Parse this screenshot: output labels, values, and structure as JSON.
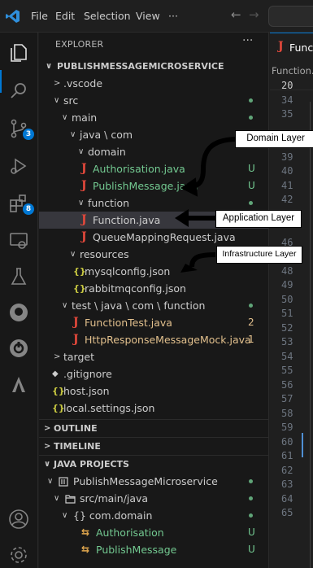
{
  "menu": {
    "file": "File",
    "edit": "Edit",
    "selection": "Selection",
    "view": "View",
    "more": "···",
    "back": "←",
    "forward": "→"
  },
  "activity_bar": {
    "icons": [
      "explorer-icon",
      "search-icon",
      "source-control-icon",
      "run-debug-icon",
      "extensions-icon",
      "remote-explorer-icon",
      "testing-icon",
      "github-icon",
      "azure-icon",
      "docker-icon",
      "account-icon",
      "settings-icon"
    ],
    "source_control_badge": "3",
    "extensions_badge": "8"
  },
  "sidebar": {
    "header": "EXPLORER",
    "more": "···",
    "project": "PUBLISHMESSAGEMICROSERVICE",
    "tree": [
      {
        "label": ".vscode",
        "chev": ">",
        "status": ""
      },
      {
        "label": "src",
        "chev": "∨",
        "status": "dot"
      },
      {
        "label": "main",
        "chev": "∨",
        "status": "dot"
      },
      {
        "label": "java \\ com",
        "chev": "∨",
        "status": ""
      },
      {
        "label": "domain",
        "chev": "∨",
        "status": ""
      },
      {
        "label": "Authorisation.java",
        "chev": "",
        "status": "U"
      },
      {
        "label": "PublishMessage.java",
        "chev": "",
        "status": "U"
      },
      {
        "label": "function",
        "chev": "∨",
        "status": "dot"
      },
      {
        "label": "Function.java",
        "chev": "",
        "status": ""
      },
      {
        "label": "QueueMappingRequest.java",
        "chev": "",
        "status": ""
      },
      {
        "label": "resources",
        "chev": "∨",
        "status": ""
      },
      {
        "label": "mysqlconfig.json",
        "chev": "",
        "status": ""
      },
      {
        "label": "rabbitmqconfig.json",
        "chev": "",
        "status": ""
      },
      {
        "label": "test \\ java \\ com \\ function",
        "chev": "∨",
        "status": "dot"
      },
      {
        "label": "FunctionTest.java",
        "chev": "",
        "status": "2"
      },
      {
        "label": "HttpResponseMessageMock.java",
        "chev": "",
        "status": "1"
      },
      {
        "label": "target",
        "chev": ">",
        "status": ""
      },
      {
        "label": ".gitignore",
        "chev": "",
        "status": ""
      },
      {
        "label": "host.json",
        "chev": "",
        "status": ""
      },
      {
        "label": "local.settings.json",
        "chev": "",
        "status": ""
      }
    ],
    "outline": "OUTLINE",
    "timeline": "TIMELINE",
    "java_projects": "JAVA PROJECTS",
    "java_tree": [
      {
        "label": "PublishMessageMicroservice",
        "status": "dot"
      },
      {
        "label": "src/main/java",
        "status": "dot"
      },
      {
        "label": "{} com.domain",
        "status": "dot"
      },
      {
        "label": "Authorisation",
        "status": "U"
      },
      {
        "label": "PublishMessage",
        "status": "U"
      }
    ],
    "section_chev_closed": ">",
    "section_chev_open": "∨"
  },
  "editor": {
    "tab_label": "Function.java",
    "breadcrumb": "Function.java",
    "line_numbers": [
      "20",
      "34",
      "35",
      "",
      "38",
      "39",
      "40",
      "41",
      "42",
      "43",
      "",
      "46",
      "47",
      "48",
      "49",
      "50",
      "51",
      "52",
      "53",
      "54",
      "55",
      "56",
      "57",
      "58",
      "59",
      "60",
      "61",
      "62",
      "63",
      "64",
      "65"
    ]
  },
  "annotations": {
    "domain": "Domain Layer",
    "application": "Application Layer",
    "infrastructure": "Infrastructure Layer"
  },
  "colors": {
    "accent": "#0078d4",
    "java_icon": "#e3483b",
    "json_icon": "#cbcb41",
    "untracked": "#73c991",
    "modified": "#e2c08d"
  }
}
